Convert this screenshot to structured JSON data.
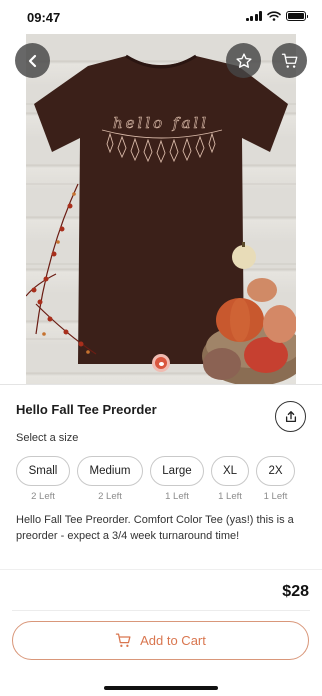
{
  "status_bar": {
    "time": "09:47"
  },
  "header": {
    "back_icon": "chevron-left-icon",
    "favorite_icon": "star-icon",
    "cart_icon": "cart-icon"
  },
  "product": {
    "title": "Hello Fall Tee Preorder",
    "image_text": "hello fall",
    "select_size_label": "Select a size",
    "sizes": [
      {
        "label": "Small",
        "stock": "2 Left"
      },
      {
        "label": "Medium",
        "stock": "2 Left"
      },
      {
        "label": "Large",
        "stock": "1 Left"
      },
      {
        "label": "XL",
        "stock": "1 Left"
      },
      {
        "label": "2X",
        "stock": "1 Left"
      }
    ],
    "description": "Hello Fall Tee Preorder. Comfort Color Tee (yas!) this is a preorder - expect a 3/4 week turnaround time!"
  },
  "footer": {
    "price": "$28",
    "add_to_cart_label": "Add to Cart"
  },
  "colors": {
    "accent": "#d9764f",
    "accent_border": "#d9977a",
    "shirt": "#3b2019",
    "image_indicator": "#d9573f"
  }
}
